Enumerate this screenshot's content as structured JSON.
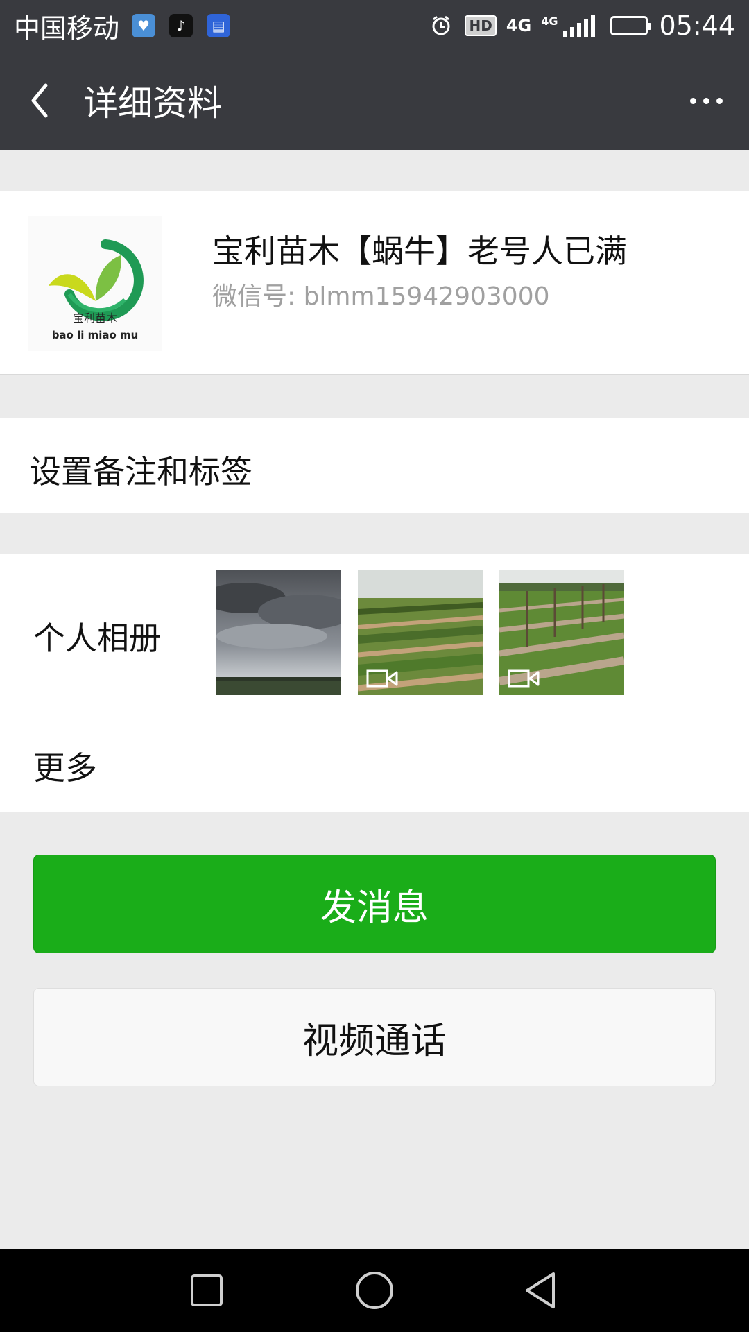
{
  "status_bar": {
    "carrier": "中国移动",
    "hd": "HD",
    "network": "4G",
    "network_small": "4G",
    "time": "05:44"
  },
  "header": {
    "title": "详细资料",
    "back_icon": "chevron-left-icon",
    "more_icon": "more-dots-icon"
  },
  "profile": {
    "name": "宝利苗木【蜗牛】老号人已满",
    "wechat_id": "微信号: blmm15942903000",
    "avatar_text_cn": "宝利苗木",
    "avatar_text_en": "bao li miao mu"
  },
  "remark": {
    "label": "设置备注和标签"
  },
  "album": {
    "label": "个人相册",
    "thumbnails": [
      {
        "kind": "photo",
        "subject": "cloudy-sky"
      },
      {
        "kind": "video",
        "subject": "field-rows"
      },
      {
        "kind": "video",
        "subject": "field-poles"
      }
    ],
    "more_label": "更多"
  },
  "actions": {
    "send_message": "发消息",
    "video_call": "视频通话"
  },
  "colors": {
    "header_bg": "#393a3f",
    "page_bg": "#ebebeb",
    "primary_green": "#1aad19",
    "secondary_gray": "#a0a0a0"
  },
  "nav_icons": [
    "recent-apps-icon",
    "home-icon",
    "back-triangle-icon"
  ]
}
